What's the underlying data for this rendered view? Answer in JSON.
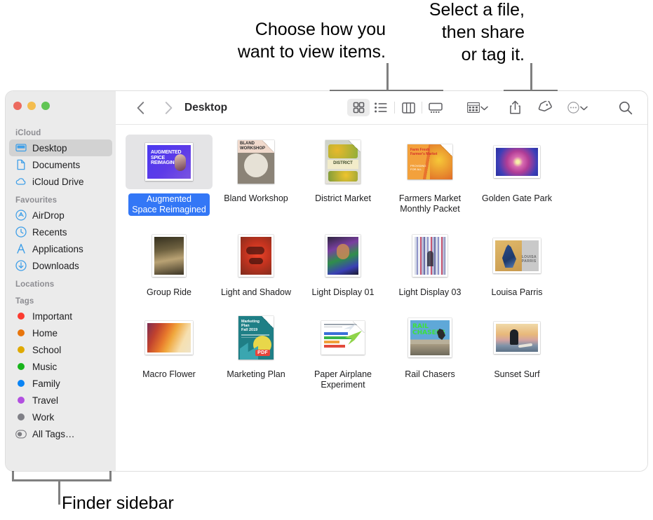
{
  "callouts": {
    "view": "Choose how you\nwant to view items.",
    "share": "Select a file,\nthen share\nor tag it.",
    "sidebar": "Finder sidebar"
  },
  "window": {
    "traffic_lights": [
      {
        "name": "close",
        "color": "#ec6a5f"
      },
      {
        "name": "minimize",
        "color": "#f4bd4f"
      },
      {
        "name": "zoom",
        "color": "#61c554"
      }
    ]
  },
  "toolbar": {
    "back": "back-icon",
    "forward": "forward-icon",
    "path": "Desktop",
    "view_modes": [
      {
        "name": "icon-view",
        "icon": "grid-icon",
        "active": true
      },
      {
        "name": "list-view",
        "icon": "list-icon",
        "active": false
      },
      {
        "name": "column-view",
        "icon": "columns-icon",
        "active": false
      },
      {
        "name": "gallery-view",
        "icon": "gallery-icon",
        "active": false
      }
    ],
    "group_by": "group-icon",
    "share": "share-icon",
    "tag": "tag-icon",
    "more": "more-icon",
    "search": "search-icon"
  },
  "sidebar": {
    "sections": [
      {
        "title": "iCloud",
        "items": [
          {
            "label": "Desktop",
            "icon": "desktop-icon",
            "selected": true
          },
          {
            "label": "Documents",
            "icon": "document-icon",
            "selected": false
          },
          {
            "label": "iCloud Drive",
            "icon": "cloud-icon",
            "selected": false
          }
        ]
      },
      {
        "title": "Favourites",
        "items": [
          {
            "label": "AirDrop",
            "icon": "airdrop-icon",
            "selected": false
          },
          {
            "label": "Recents",
            "icon": "clock-icon",
            "selected": false
          },
          {
            "label": "Applications",
            "icon": "applications-icon",
            "selected": false
          },
          {
            "label": "Downloads",
            "icon": "download-icon",
            "selected": false
          }
        ]
      },
      {
        "title": "Locations",
        "items": []
      },
      {
        "title": "Tags",
        "items": [
          {
            "label": "Important",
            "icon": "tag-dot",
            "color": "#fc3b30",
            "selected": false
          },
          {
            "label": "Home",
            "icon": "tag-dot",
            "color": "#e8750c",
            "selected": false
          },
          {
            "label": "School",
            "icon": "tag-dot",
            "color": "#dfa900",
            "selected": false
          },
          {
            "label": "Music",
            "icon": "tag-dot",
            "color": "#17b41b",
            "selected": false
          },
          {
            "label": "Family",
            "icon": "tag-dot",
            "color": "#0a84f5",
            "selected": false
          },
          {
            "label": "Travel",
            "icon": "tag-dot",
            "color": "#b24fe0",
            "selected": false
          },
          {
            "label": "Work",
            "icon": "tag-dot",
            "color": "#7f7f86",
            "selected": false
          },
          {
            "label": "All Tags…",
            "icon": "all-tags-icon",
            "color": "",
            "selected": false
          }
        ]
      }
    ]
  },
  "files": [
    {
      "label": "Augmented\nSpace Reimagined",
      "kind": "image",
      "selected": true
    },
    {
      "label": "Bland Workshop",
      "kind": "document",
      "selected": false
    },
    {
      "label": "District Market",
      "kind": "document",
      "selected": false
    },
    {
      "label": "Farmers Market\nMonthly Packet",
      "kind": "document",
      "selected": false
    },
    {
      "label": "Golden Gate Park",
      "kind": "photo",
      "selected": false
    },
    {
      "label": "Group Ride",
      "kind": "photo",
      "selected": false
    },
    {
      "label": "Light and Shadow",
      "kind": "photo",
      "selected": false
    },
    {
      "label": "Light Display 01",
      "kind": "photo",
      "selected": false
    },
    {
      "label": "Light Display 03",
      "kind": "photo",
      "selected": false
    },
    {
      "label": "Louisa Parris",
      "kind": "photo",
      "selected": false
    },
    {
      "label": "Macro Flower",
      "kind": "photo",
      "selected": false
    },
    {
      "label": "Marketing Plan",
      "kind": "pdf",
      "selected": false
    },
    {
      "label": "Paper Airplane\nExperiment",
      "kind": "document",
      "selected": false
    },
    {
      "label": "Rail Chasers",
      "kind": "image",
      "selected": false
    },
    {
      "label": "Sunset Surf",
      "kind": "photo",
      "selected": false
    }
  ]
}
